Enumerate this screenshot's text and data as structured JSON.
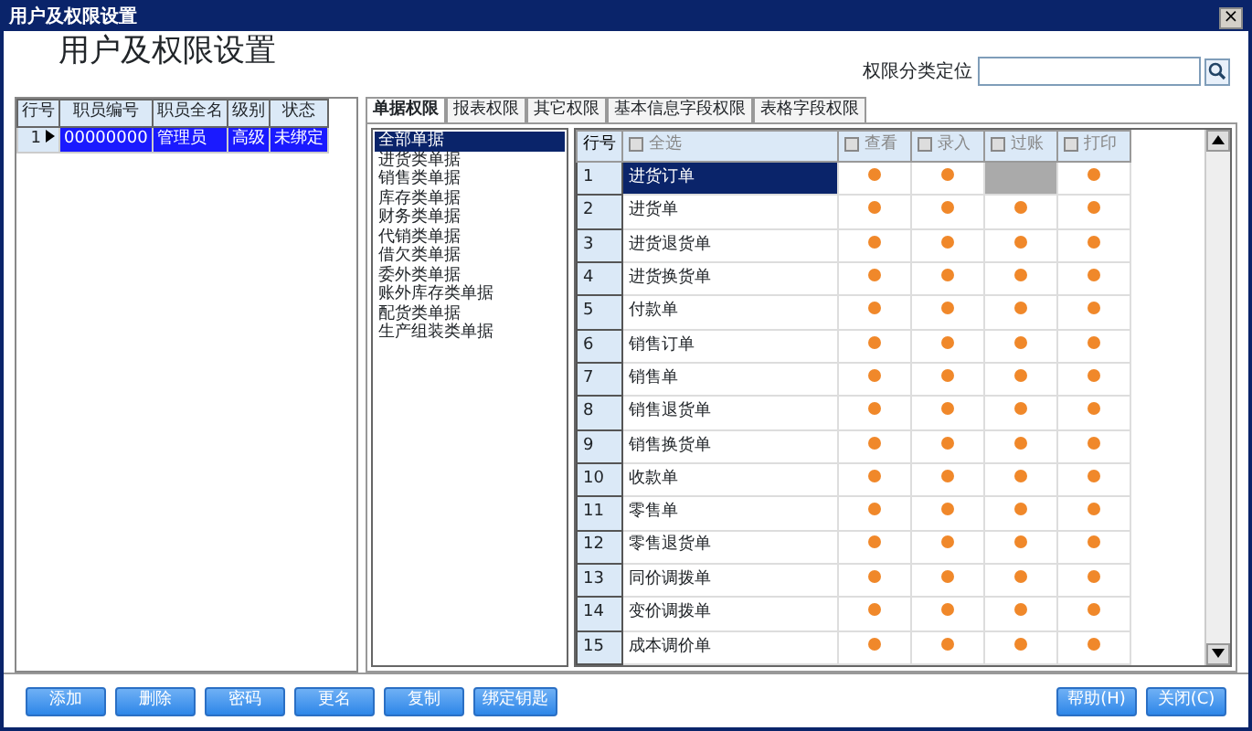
{
  "window": {
    "title": "用户及权限设置",
    "close": "×"
  },
  "heading": "用户及权限设置",
  "search": {
    "label": "权限分类定位"
  },
  "employees": {
    "columns": [
      "行号",
      "职员编号",
      "职员全名",
      "级别",
      "状态"
    ],
    "rows": [
      {
        "cells": [
          "1",
          "00000000",
          "管理员",
          "高级",
          "未绑定"
        ],
        "selected": true
      }
    ]
  },
  "tabs": [
    {
      "label": "单据权限",
      "selected": true
    },
    {
      "label": "报表权限",
      "selected": false
    },
    {
      "label": "其它权限",
      "selected": false
    },
    {
      "label": "基本信息字段权限",
      "selected": false
    },
    {
      "label": "表格字段权限",
      "selected": false
    }
  ],
  "categories": [
    {
      "label": "全部单据",
      "selected": true
    },
    {
      "label": "进货类单据",
      "selected": false
    },
    {
      "label": "销售类单据",
      "selected": false
    },
    {
      "label": "库存类单据",
      "selected": false
    },
    {
      "label": "财务类单据",
      "selected": false
    },
    {
      "label": "代销类单据",
      "selected": false
    },
    {
      "label": "借欠类单据",
      "selected": false
    },
    {
      "label": "委外类单据",
      "selected": false
    },
    {
      "label": "账外库存类单据",
      "selected": false
    },
    {
      "label": "配货类单据",
      "selected": false
    },
    {
      "label": "生产组装类单据",
      "selected": false
    }
  ],
  "permissions": {
    "row_header": "行号",
    "columns": [
      {
        "label": "全选",
        "checked": false
      },
      {
        "label": "查看",
        "checked": false
      },
      {
        "label": "录入",
        "checked": false
      },
      {
        "label": "过账",
        "checked": false
      },
      {
        "label": "打印",
        "checked": false
      }
    ],
    "rows": [
      {
        "no": "1",
        "name": "进货订单",
        "selected": true,
        "perms": [
          true,
          true,
          false,
          true
        ]
      },
      {
        "no": "2",
        "name": "进货单",
        "selected": false,
        "perms": [
          true,
          true,
          true,
          true
        ]
      },
      {
        "no": "3",
        "name": "进货退货单",
        "selected": false,
        "perms": [
          true,
          true,
          true,
          true
        ]
      },
      {
        "no": "4",
        "name": "进货换货单",
        "selected": false,
        "perms": [
          true,
          true,
          true,
          true
        ]
      },
      {
        "no": "5",
        "name": "付款单",
        "selected": false,
        "perms": [
          true,
          true,
          true,
          true
        ]
      },
      {
        "no": "6",
        "name": "销售订单",
        "selected": false,
        "perms": [
          true,
          true,
          true,
          true
        ]
      },
      {
        "no": "7",
        "name": "销售单",
        "selected": false,
        "perms": [
          true,
          true,
          true,
          true
        ]
      },
      {
        "no": "8",
        "name": "销售退货单",
        "selected": false,
        "perms": [
          true,
          true,
          true,
          true
        ]
      },
      {
        "no": "9",
        "name": "销售换货单",
        "selected": false,
        "perms": [
          true,
          true,
          true,
          true
        ]
      },
      {
        "no": "10",
        "name": "收款单",
        "selected": false,
        "perms": [
          true,
          true,
          true,
          true
        ]
      },
      {
        "no": "11",
        "name": "零售单",
        "selected": false,
        "perms": [
          true,
          true,
          true,
          true
        ]
      },
      {
        "no": "12",
        "name": "零售退货单",
        "selected": false,
        "perms": [
          true,
          true,
          true,
          true
        ]
      },
      {
        "no": "13",
        "name": "同价调拨单",
        "selected": false,
        "perms": [
          true,
          true,
          true,
          true
        ]
      },
      {
        "no": "14",
        "name": "变价调拨单",
        "selected": false,
        "perms": [
          true,
          true,
          true,
          true
        ]
      },
      {
        "no": "15",
        "name": "成本调价单",
        "selected": false,
        "perms": [
          true,
          true,
          true,
          true
        ]
      }
    ]
  },
  "buttons_left": [
    "添加",
    "删除",
    "密码",
    "更名",
    "复制",
    "绑定钥匙"
  ],
  "buttons_right": [
    "帮助(H)",
    "关闭(C)"
  ]
}
